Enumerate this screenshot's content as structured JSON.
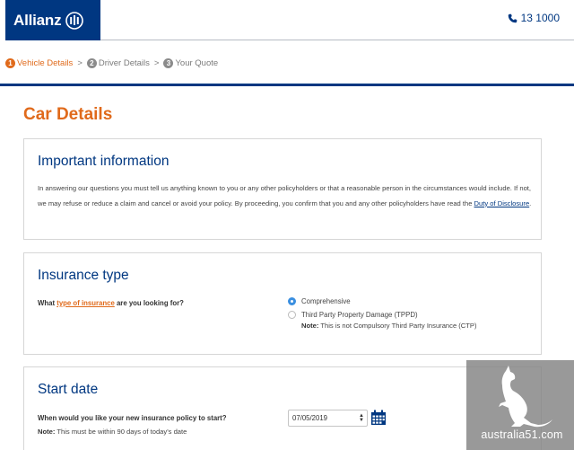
{
  "header": {
    "brand": "Allianz",
    "phone": "13 1000"
  },
  "steps": [
    {
      "num": "1",
      "label": "Vehicle Details",
      "active": true
    },
    {
      "num": "2",
      "label": "Driver Details",
      "active": false
    },
    {
      "num": "3",
      "label": "Your Quote",
      "active": false
    }
  ],
  "step_separator": ">",
  "page_title": "Car Details",
  "important": {
    "heading": "Important information",
    "body": "In answering our questions you must tell us anything known to you or any other policyholders or that a reasonable person in the circumstances would include. If not, we may refuse or reduce a claim and cancel or avoid your policy. By proceeding, you confirm that you and any other policyholders have read the ",
    "link": "Duty of Disclosure",
    "end": "."
  },
  "insurance": {
    "heading": "Insurance type",
    "question_pre": "What ",
    "question_link": "type of insurance",
    "question_post": " are you looking for?",
    "options": [
      {
        "label": "Comprehensive",
        "selected": true
      },
      {
        "label": "Third Party Property Damage  (TPPD)",
        "selected": false
      }
    ],
    "note_label": "Note:",
    "note_text": " This is not Compulsory Third Party Insurance (CTP)"
  },
  "start_date": {
    "heading": "Start date",
    "question": "When would you like your new insurance policy to start?",
    "note_label": "Note:",
    "note_text": " This must be within 90 days of today's date",
    "value": "07/05/2019"
  },
  "watermark": {
    "text": "australia51.com"
  },
  "colors": {
    "brand_blue": "#003781",
    "accent_orange": "#e06a1b",
    "radio_blue": "#3a8fe0"
  }
}
